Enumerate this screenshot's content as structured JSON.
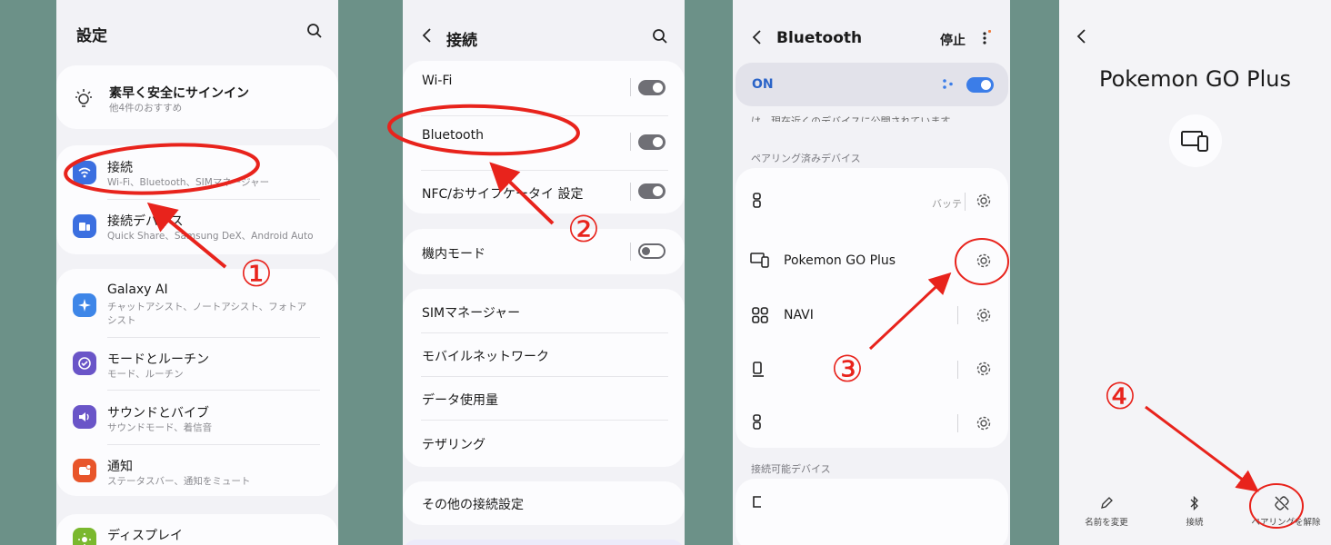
{
  "p1": {
    "title": "設定",
    "signin_title": "素早く安全にサインイン",
    "signin_sub": "他4件のおすすめ",
    "items": [
      {
        "title": "接続",
        "sub": "Wi-Fi、Bluetooth、SIMマネージャー"
      },
      {
        "title": "接続デバイス",
        "sub": "Quick Share、Samsung DeX、Android Auto"
      },
      {
        "title": "Galaxy AI",
        "sub": "チャットアシスト、ノートアシスト、フォトア",
        "sub2": "シスト"
      },
      {
        "title": "モードとルーチン",
        "sub": "モード、ルーチン"
      },
      {
        "title": "サウンドとバイブ",
        "sub": "サウンドモード、着信音"
      },
      {
        "title": "通知",
        "sub": "ステータスバー、通知をミュート"
      },
      {
        "title": "ディスプレイ",
        "sub": ""
      }
    ]
  },
  "p2": {
    "title": "接続",
    "items": [
      "Wi-Fi",
      "Bluetooth",
      "NFC/おサイフケータイ 設定",
      "機内モード",
      "SIMマネージャー",
      "モバイルネットワーク",
      "データ使用量",
      "テザリング",
      "その他の接続設定"
    ]
  },
  "p3": {
    "title": "Bluetooth",
    "stop": "停止",
    "on_label": "ON",
    "clipped_text": "は、現在近くのデバイスに公開されています。",
    "paired_header": "ペアリング済みデバイス",
    "battery_text": "バッテ",
    "devices": [
      "Pokemon GO Plus",
      "NAVI"
    ],
    "available_header": "接続可能デバイス"
  },
  "p4": {
    "title": "Pokemon GO Plus",
    "actions": [
      "名前を変更",
      "接続",
      "ペアリングを解除"
    ]
  },
  "annotations": {
    "n1": "①",
    "n2": "②",
    "n3": "③",
    "n4": "④",
    "color": "#e8231c"
  }
}
